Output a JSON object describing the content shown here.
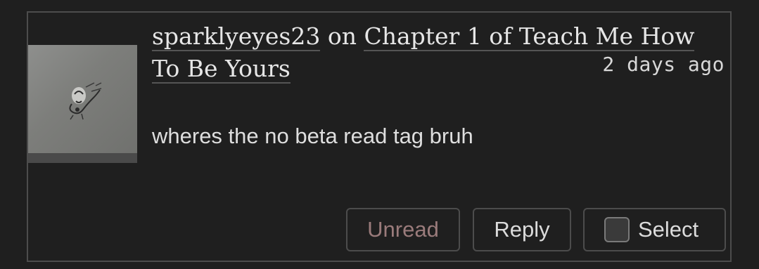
{
  "comment": {
    "author": "sparklyeyes23",
    "on_word": "on",
    "work_title": "Chapter 1 of Teach Me How To Be Yours",
    "timestamp": "2 days ago",
    "body": "wheres the no beta read tag bruh"
  },
  "actions": {
    "unread_label": "Unread",
    "reply_label": "Reply",
    "select_label": "Select",
    "select_checked": false
  },
  "colors": {
    "background": "#1f1f1f",
    "border": "#4c4c4c",
    "text": "#e6e6e6",
    "unread_text": "#9a7b7b"
  }
}
